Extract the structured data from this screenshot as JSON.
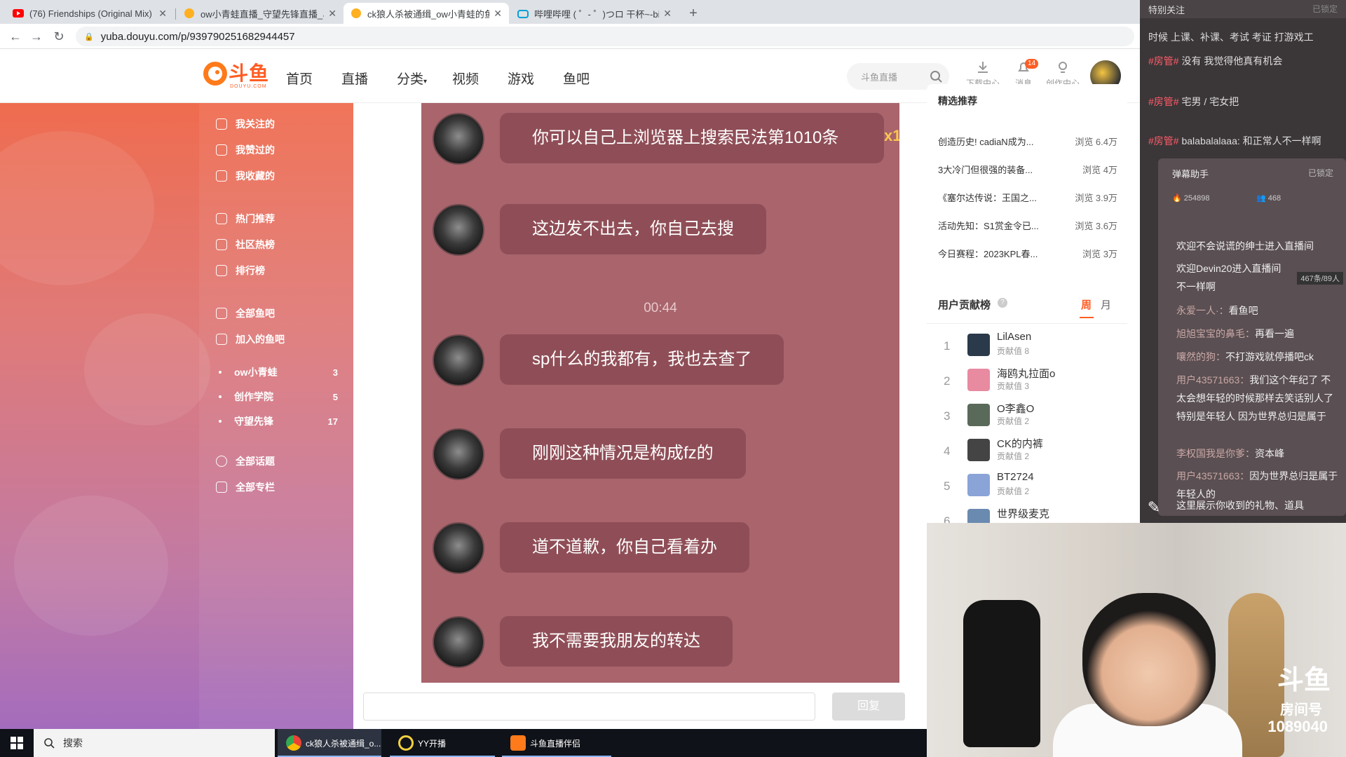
{
  "browser": {
    "tabs": [
      {
        "title": "(76) Friendships (Original Mix)",
        "active": false
      },
      {
        "title": "ow小青蛙直播_守望先锋直播_斗",
        "active": false
      },
      {
        "title": "ck狼人杀被通缉_ow小青蛙的鱼吧",
        "active": true
      },
      {
        "title": "哔哩哔哩 ( ゜- ゜)つロ 干杯~-bili",
        "active": false
      }
    ],
    "url": "yuba.douyu.com/p/939790251682944457"
  },
  "header": {
    "logo_text": "斗鱼",
    "logo_sub": "DOUYU.COM",
    "nav": [
      "首页",
      "直播",
      "分类",
      "视频",
      "游戏",
      "鱼吧"
    ],
    "search_placeholder": "斗鱼直播",
    "icons": [
      {
        "label": "下载中心",
        "icon": "download-icon"
      },
      {
        "label": "消息",
        "icon": "bell-icon",
        "badge": "14"
      },
      {
        "label": "创作中心",
        "icon": "bulb-icon"
      }
    ]
  },
  "sidebar": {
    "groups": [
      [
        "我关注的",
        "我赞过的",
        "我收藏的"
      ],
      [
        "热门推荐",
        "社区热榜",
        "排行榜"
      ],
      [
        "全部鱼吧",
        "加入的鱼吧"
      ]
    ],
    "joined": [
      {
        "name": "ow小青蛙",
        "count": "3"
      },
      {
        "name": "创作学院",
        "count": "5"
      },
      {
        "name": "守望先锋",
        "count": "17"
      }
    ],
    "bottom": [
      "全部话题",
      "全部专栏"
    ]
  },
  "chat": {
    "messages": [
      "你可以自己上浏览器上搜索民法第1010条",
      "这边发不出去，你自己去搜",
      "sp什么的我都有，我也去查了",
      "刚刚这种情况是构成fz的",
      "道不道歉，你自己看着办",
      "我不需要我朋友的转达"
    ],
    "time": "00:44",
    "gift_count": "x1"
  },
  "reply": {
    "button": "回复"
  },
  "hot": {
    "title": "精选推荐",
    "items": [
      {
        "title": "创造历史! cadiaN成为...",
        "views": "浏览 6.4万"
      },
      {
        "title": "3大冷门但很强的装备...",
        "views": "浏览 4万"
      },
      {
        "title": "《塞尔达传说：王国之...",
        "views": "浏览 3.9万"
      },
      {
        "title": "活动先知：S1赏金令已...",
        "views": "浏览 3.6万"
      },
      {
        "title": "今日赛程：2023KPL春...",
        "views": "浏览 3万"
      }
    ]
  },
  "ranking": {
    "title": "用户贡献榜",
    "tab_week": "周",
    "tab_month": "月",
    "rows": [
      {
        "rank": "1",
        "name": "LilAsen",
        "score": "贡献值 8",
        "color": "#2a3a4a"
      },
      {
        "rank": "2",
        "name": "海鸥丸拉面o",
        "score": "贡献值 3",
        "color": "#e88aa0"
      },
      {
        "rank": "3",
        "name": "O李鑫O",
        "score": "贡献值 2",
        "color": "#5a6a5a"
      },
      {
        "rank": "4",
        "name": "CK的内裤",
        "score": "贡献值 2",
        "color": "#444444"
      },
      {
        "rank": "5",
        "name": "BT2724",
        "score": "贡献值 2",
        "color": "#8aa4d8"
      },
      {
        "rank": "6",
        "name": "世界级麦克",
        "score": "",
        "color": "#6a8ab0"
      }
    ]
  },
  "danmaku": {
    "top_label": "特别关注",
    "top_hint": "已锁定",
    "lines": [
      {
        "tag": "",
        "text": "时候 上课、补课、考试 考证 打游戏工"
      },
      {
        "tag": "#房管#",
        "text": "没有 我觉得他真有机会"
      },
      {
        "tag": "#房管#",
        "text": "宅男 / 宅女把"
      },
      {
        "tag": "#房管#",
        "text": "balabalalaaa: 和正常人不一样啊"
      }
    ],
    "assistant_title": "弹幕助手",
    "assistant_locked": "已锁定",
    "stat1": "254898",
    "stat2": "468",
    "assist_lines": [
      {
        "user": "",
        "text": "欢迎不会说谎的绅士进入直播间"
      },
      {
        "user": "",
        "text": "欢迎Devin20进入直播间"
      },
      {
        "user": "",
        "text": "不一样啊"
      },
      {
        "user": "永爱一人·：",
        "text": "看鱼吧"
      },
      {
        "user": "旭旭宝宝的鼻毛：",
        "text": "再看一遍"
      },
      {
        "user": "嚷然的狗：",
        "text": "不打游戏就停播吧ck"
      },
      {
        "user": "用户43571663：",
        "text": "我们这个年纪了 不太会想年轻的时候那样去笑话别人了 特别是年轻人 因为世界总归是属于"
      },
      {
        "user": "李权国我是你爹：",
        "text": "资本峰"
      },
      {
        "user": "用户43571663：",
        "text": "因为世界总归是属于年轻人的"
      },
      {
        "user": "",
        "text": "这里展示你收到的礼物、道具"
      }
    ],
    "count_badge": "467条/89人"
  },
  "webcam": {
    "logo": "斗鱼",
    "room_label": "房间号",
    "room_no": "1089040"
  },
  "taskbar": {
    "search": "搜索",
    "apps": [
      {
        "label": "ck狼人杀被通缉_o...",
        "color": "#ea4335",
        "active": true
      },
      {
        "label": "YY开播",
        "color": "#f4d03f",
        "active": false
      },
      {
        "label": "斗鱼直播伴侣",
        "color": "#ff7a1a",
        "active": false
      }
    ]
  }
}
